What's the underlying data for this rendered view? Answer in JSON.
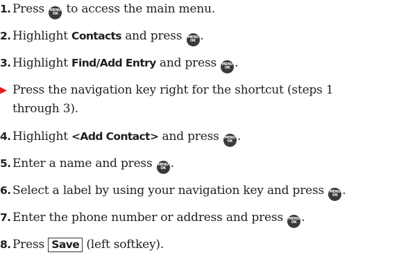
{
  "menu_button": {
    "top_text": "MENU",
    "bottom_text": "OK",
    "icon": "menu-ok-button-icon"
  },
  "steps": [
    {
      "number": "1.",
      "text_before": "Press ",
      "text_after": " to access the main menu."
    },
    {
      "number": "2.",
      "text_before": "Highlight ",
      "ui_text": "Contacts",
      "text_middle": " and press ",
      "text_after": "."
    },
    {
      "number": "3.",
      "text_before": "Highlight ",
      "ui_text": "Find/Add Entry",
      "text_middle": " and press ",
      "text_after": "."
    },
    {
      "bullet_icon": "red-arrow-bullet-icon",
      "line1": "Press the navigation key right for the shortcut (steps 1",
      "line2": "through 3)."
    },
    {
      "number": "4.",
      "text_before": "Highlight ",
      "ui_text": "<Add Contact>",
      "text_middle": " and press ",
      "text_after": "."
    },
    {
      "number": "5.",
      "text_before": "Enter a name and press ",
      "text_after": "."
    },
    {
      "number": "6.",
      "text_before": "Select a label by using your navigation key and press ",
      "text_after": "."
    },
    {
      "number": "7.",
      "text_before": "Enter the phone number or address and press ",
      "text_after": "."
    },
    {
      "number": "8.",
      "text_before": "Press ",
      "softkey": "Save",
      "text_after": " (left softkey)."
    }
  ],
  "colors": {
    "text": "#1f1f1f",
    "bullet": "#e01b1b",
    "button": "#3a3a3a"
  }
}
